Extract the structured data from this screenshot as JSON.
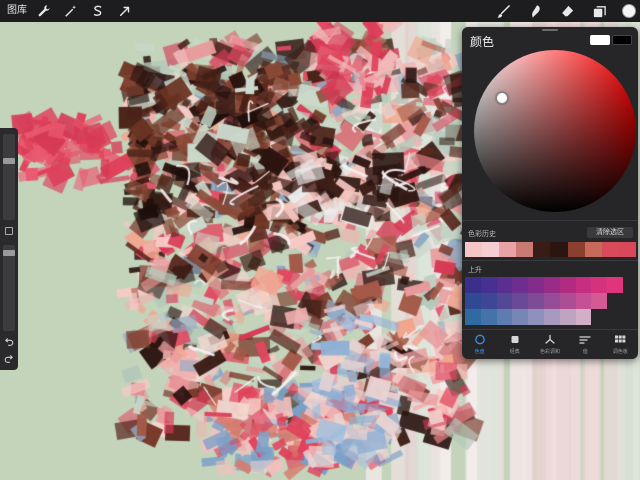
{
  "app": {
    "gallery_label": "图库"
  },
  "toolbar": {
    "left_icons": [
      "wrench-icon",
      "magic-wand-icon",
      "selection-icon",
      "transform-arrow-icon"
    ],
    "right_icons": [
      "brush-icon",
      "smudge-icon",
      "eraser-icon",
      "layers-icon"
    ],
    "current_color": "#f4f4f4"
  },
  "sidebar": {
    "brush_size_level": 0.35,
    "opacity_level": 0.25,
    "undo_icon": "undo-icon",
    "redo_icon": "redo-icon"
  },
  "color_panel": {
    "title": "颜色",
    "primary_color": "#ffffff",
    "secondary_color": "#000000",
    "hue_color": "#ff0000",
    "history_label": "色彩历史",
    "clear_label": "清除选区",
    "history_colors": [
      "#f4c6c6",
      "#f6cdd0",
      "#e8a3a6",
      "#c97a72",
      "#3a1c16",
      "#2a1510",
      "#8a3f2f",
      "#c86a5a",
      "#d94a5a",
      "#d8475a"
    ],
    "palette_label": "上升",
    "palette_colors": [
      "#3b2f8c",
      "#47308f",
      "#5a2f8f",
      "#6d2e8f",
      "#822d8c",
      "#992c88",
      "#b22b83",
      "#c72e82",
      "#d6317f",
      "#e0357c",
      "#2f4a92",
      "#3d4794",
      "#524896",
      "#684a97",
      "#7e4b97",
      "#964c96",
      "#ad4e95",
      "#c55194",
      "#d35a93",
      null,
      "#2f6aa0",
      "#4573a8",
      "#5e7cb0",
      "#7786b6",
      "#8f90bb",
      "#a79abe",
      "#bea4c1",
      "#d2afc4",
      null,
      null
    ],
    "tabs": [
      {
        "label": "色盘",
        "icon": "disc-icon",
        "active": true
      },
      {
        "label": "经典",
        "icon": "square-icon",
        "active": false
      },
      {
        "label": "色彩调和",
        "icon": "harmony-icon",
        "active": false
      },
      {
        "label": "值",
        "icon": "sliders-icon",
        "active": false
      },
      {
        "label": "调色板",
        "icon": "grid-icon",
        "active": false
      }
    ]
  }
}
